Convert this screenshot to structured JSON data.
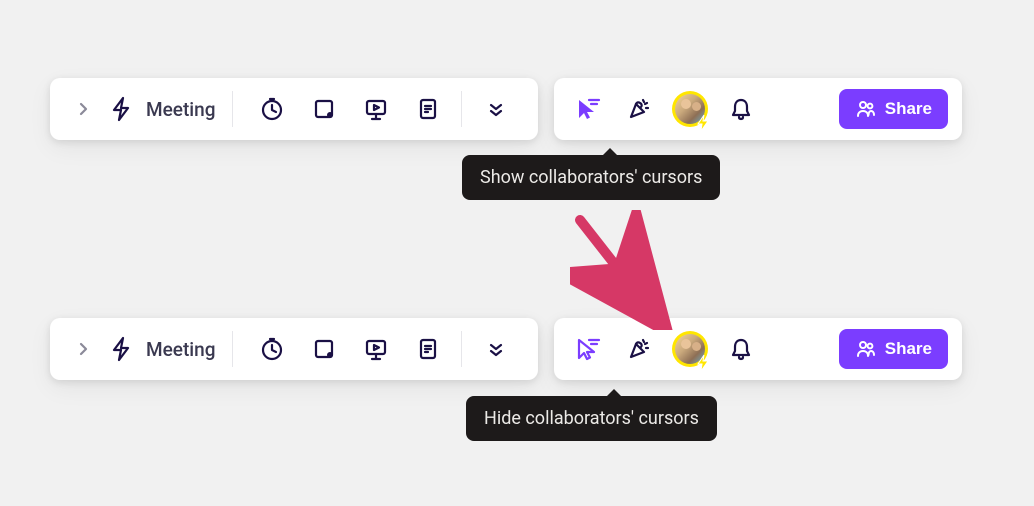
{
  "toolbar": {
    "meeting_label": "Meeting"
  },
  "share": {
    "label": "Share"
  },
  "tooltips": {
    "show_cursors": "Show collaborators' cursors",
    "hide_cursors": "Hide collaborators' cursors"
  }
}
